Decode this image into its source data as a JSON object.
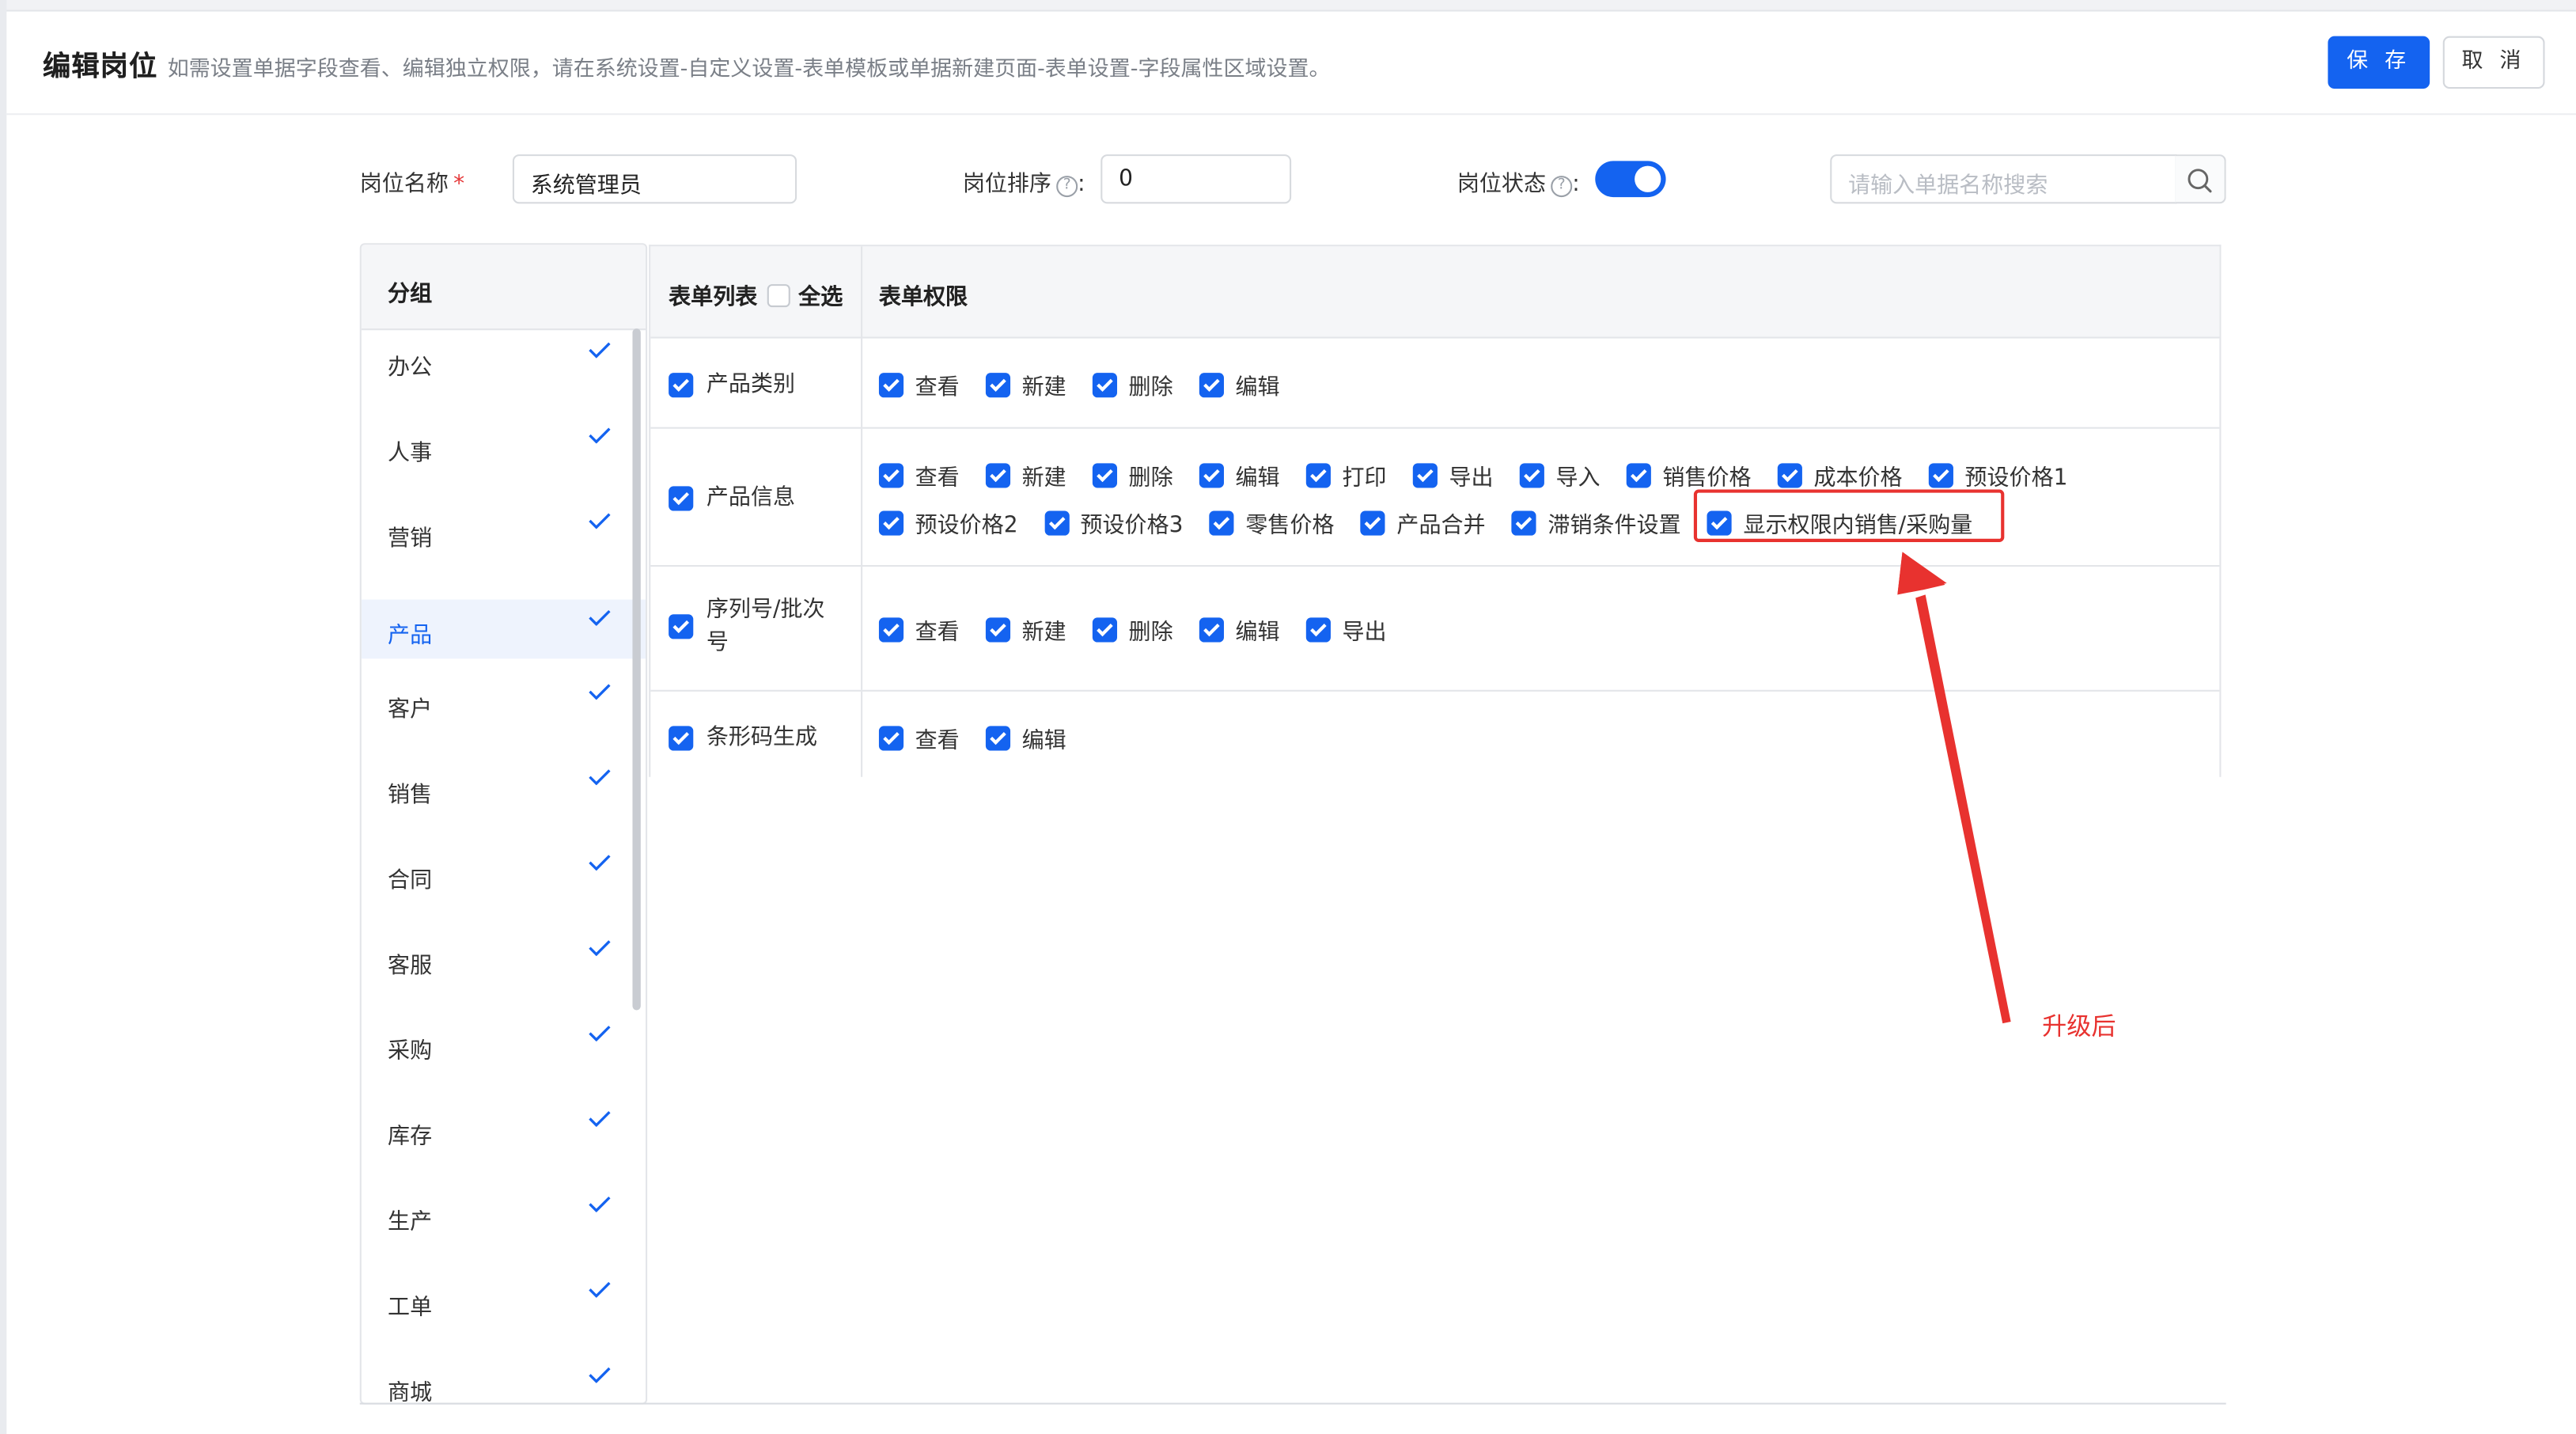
{
  "header": {
    "title": "编辑岗位",
    "hint": "如需设置单据字段查看、编辑独立权限，请在系统设置-自定义设置-表单模板或单据新建页面-表单设置-字段属性区域设置。",
    "save_label": "保 存",
    "cancel_label": "取 消"
  },
  "form": {
    "name_label": "岗位名称",
    "name_required_mark": "*",
    "name_value": "系统管理员",
    "order_label": "岗位排序",
    "order_value": "0",
    "status_label": "岗位状态",
    "status_on": true,
    "colon": ":",
    "search_placeholder": "请输入单据名称搜索",
    "help_glyph": "?"
  },
  "groups": {
    "header": "分组",
    "items": [
      {
        "label": "办公",
        "checked": true
      },
      {
        "label": "人事",
        "checked": true
      },
      {
        "label": "营销",
        "checked": true
      },
      {
        "label": "产品",
        "checked": true,
        "active": true
      },
      {
        "label": "客户",
        "checked": true
      },
      {
        "label": "销售",
        "checked": true
      },
      {
        "label": "合同",
        "checked": true
      },
      {
        "label": "客服",
        "checked": true
      },
      {
        "label": "采购",
        "checked": true
      },
      {
        "label": "库存",
        "checked": true
      },
      {
        "label": "生产",
        "checked": true
      },
      {
        "label": "工单",
        "checked": true
      },
      {
        "label": "商城",
        "checked": true
      }
    ]
  },
  "permissions": {
    "list_header": "表单列表",
    "select_all_label": "全选",
    "perm_header": "表单权限",
    "rows": [
      {
        "name": "产品类别",
        "lines": [
          [
            "查看",
            "新建",
            "删除",
            "编辑"
          ]
        ]
      },
      {
        "name": "产品信息",
        "lines": [
          [
            "查看",
            "新建",
            "删除",
            "编辑",
            "打印",
            "导出",
            "导入",
            "销售价格",
            "成本价格",
            "预设价格1"
          ],
          [
            "预设价格2",
            "预设价格3",
            "零售价格",
            "产品合并",
            "滞销条件设置",
            "显示权限内销售/采购量"
          ]
        ]
      },
      {
        "name": "序列号/批次号",
        "lines": [
          [
            "查看",
            "新建",
            "删除",
            "编辑",
            "导出"
          ]
        ]
      },
      {
        "name": "条形码生成",
        "lines": [
          [
            "查看",
            "编辑"
          ]
        ]
      }
    ]
  },
  "annotation": {
    "text": "升级后",
    "color": "#e8322f"
  },
  "colors": {
    "primary": "#1463f0",
    "border": "#e3e5e9",
    "annotation": "#e8322f"
  },
  "icons": [
    "search-icon",
    "check-icon",
    "help-circle-icon",
    "toggle-switch",
    "checkbox-checked-icon",
    "checkbox-empty-icon",
    "arrow-annotation"
  ]
}
